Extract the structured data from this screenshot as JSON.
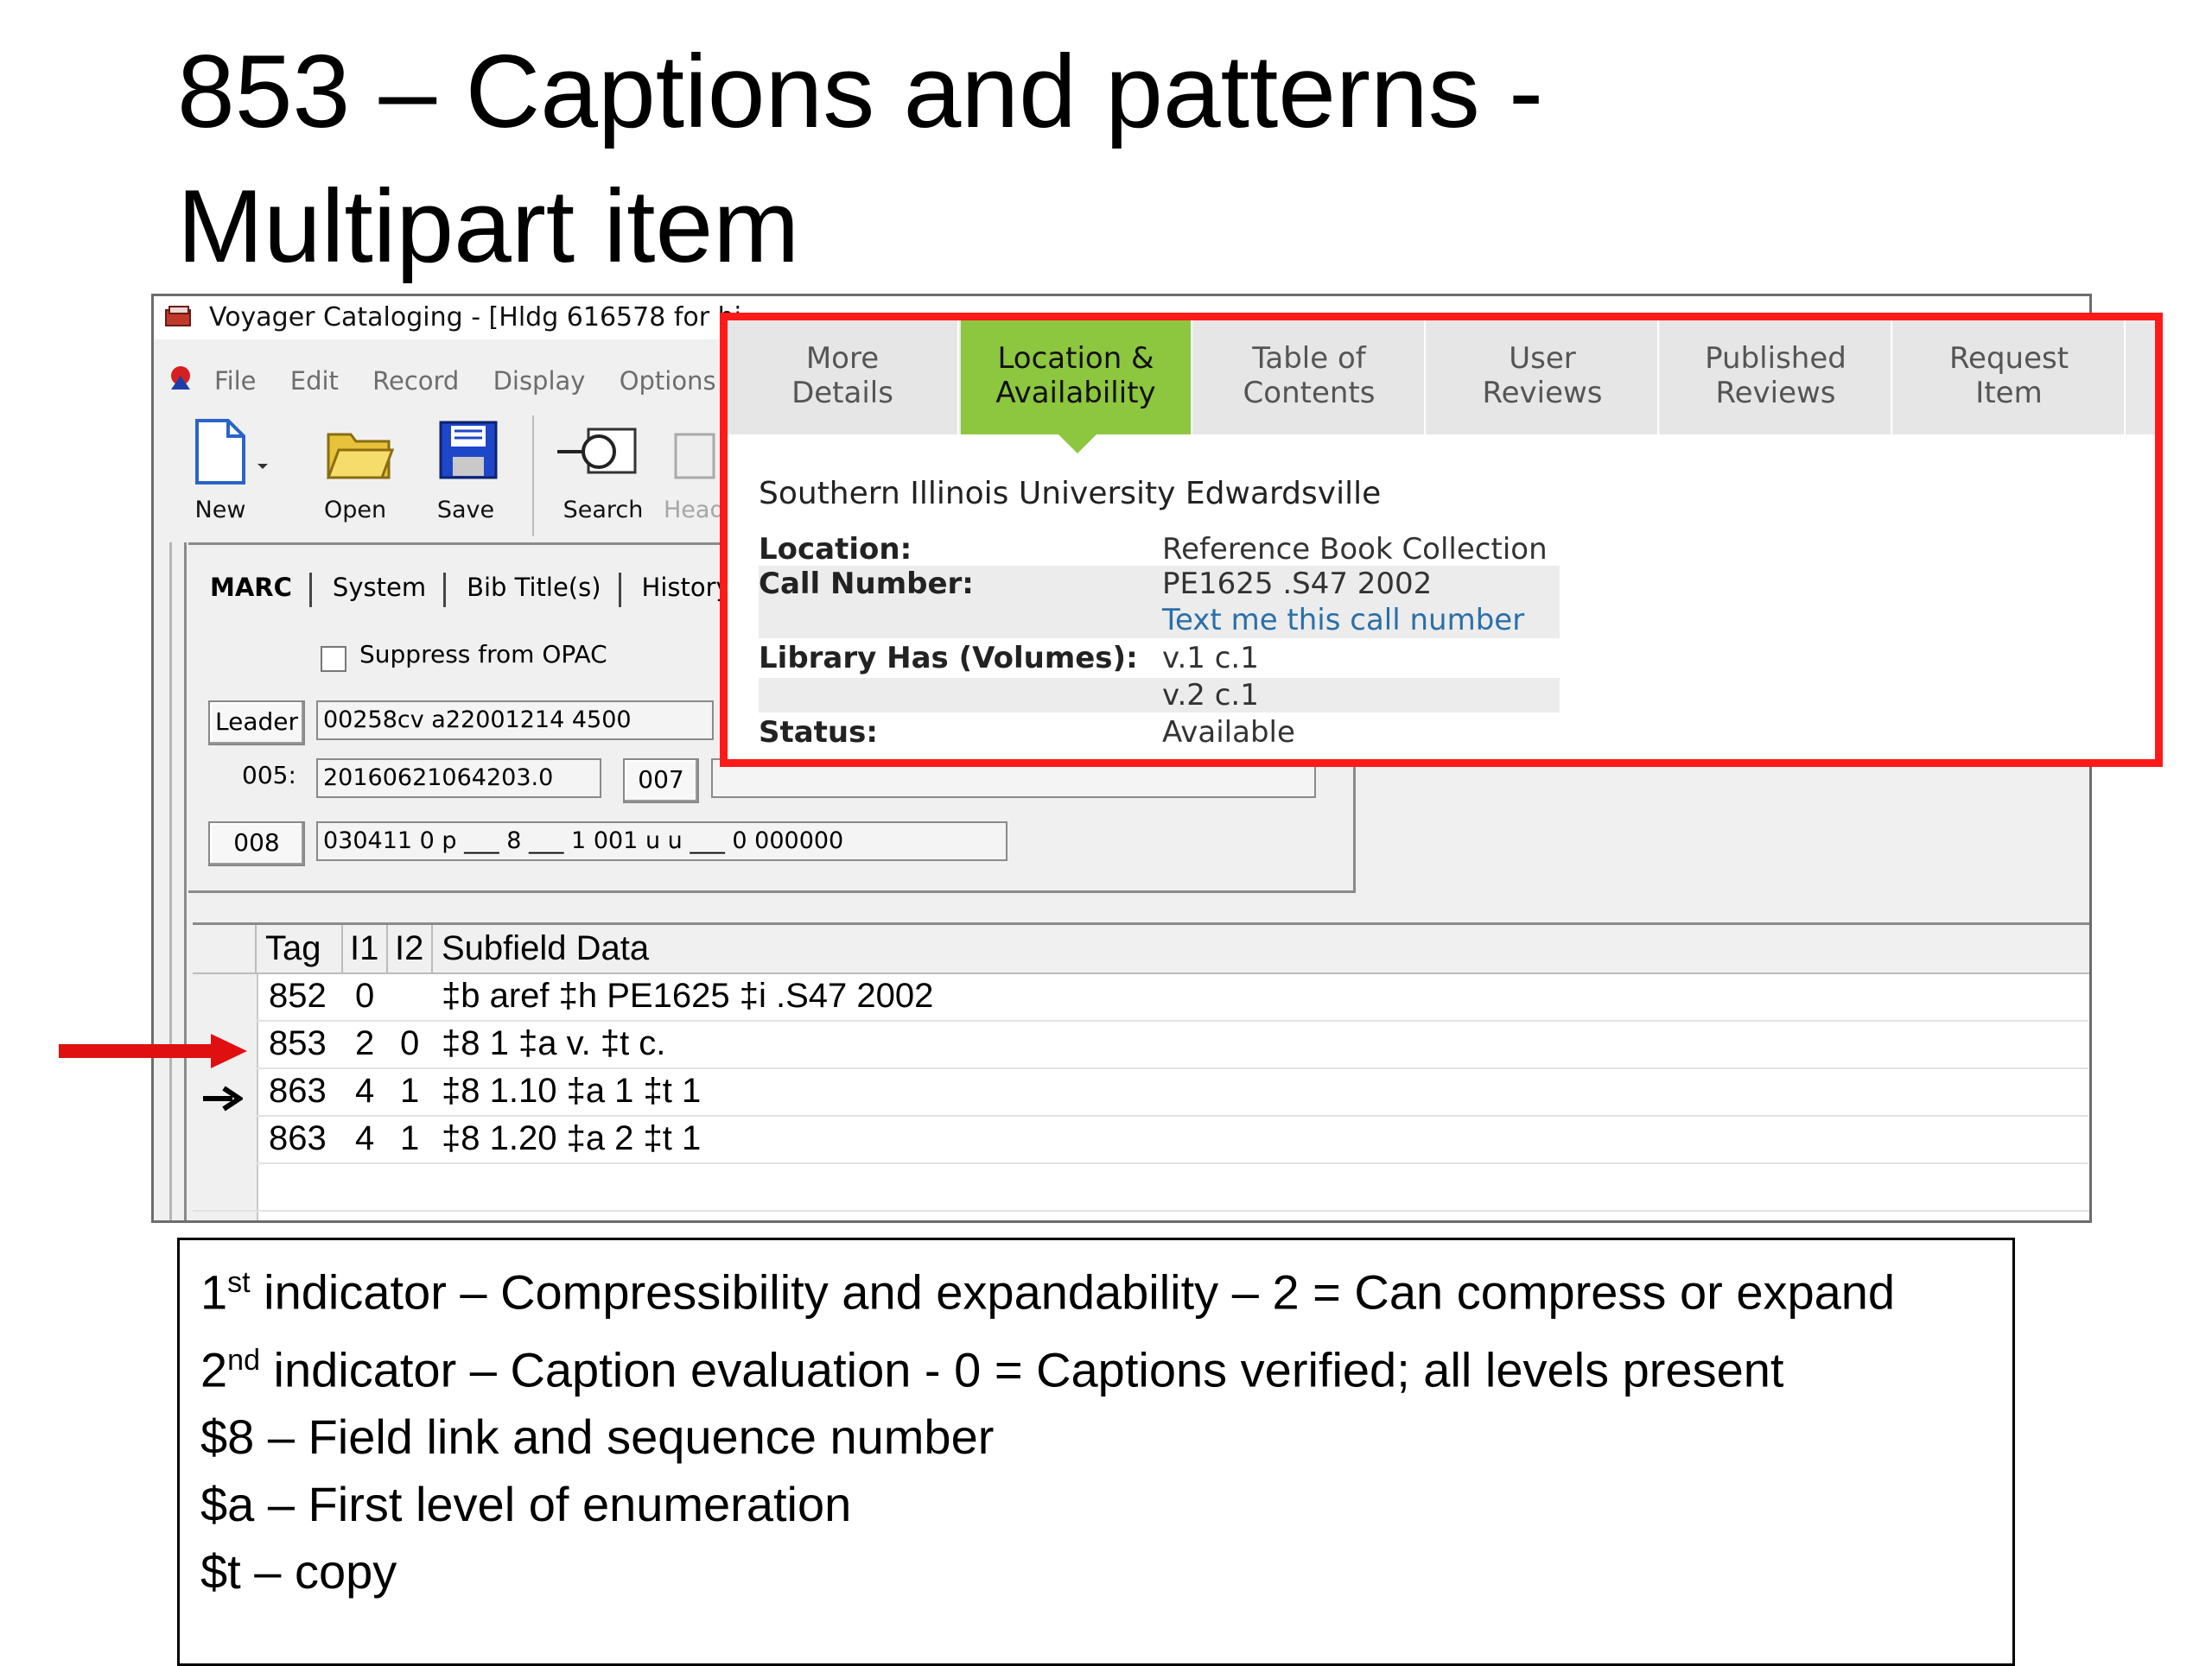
{
  "slide": {
    "title_line1": "853 – Captions and patterns -",
    "title_line2": "Multipart item"
  },
  "window": {
    "title": "Voyager Cataloging - [Hldg 616578 for bi",
    "menu": [
      "File",
      "Edit",
      "Record",
      "Display",
      "Options"
    ],
    "toolbar": {
      "new": "New",
      "open": "Open",
      "save": "Save",
      "search": "Search",
      "head": "Head"
    },
    "tabs": [
      "MARC",
      "System",
      "Bib Title(s)",
      "History"
    ],
    "suppress_label": "Suppress from OPAC",
    "leader_button": "Leader",
    "leader_value": "00258cv  a22001214  4500",
    "label_005": "005:",
    "value_005": "20160621064203.0",
    "button_007": "007",
    "button_008": "008",
    "value_008": "030411  0  p ___  8 ___  1  001  u  u ___  0  000000"
  },
  "grid": {
    "headers": [
      "Tag",
      "I1",
      "I2",
      "Subfield Data"
    ],
    "rows": [
      {
        "tag": "852",
        "i1": "0",
        "i2": "",
        "data": "‡b aref ‡h PE1625 ‡i .S47 2002"
      },
      {
        "tag": "853",
        "i1": "2",
        "i2": "0",
        "data": "‡8 1 ‡a v. ‡t c."
      },
      {
        "tag": "863",
        "i1": "4",
        "i2": "1",
        "data": "‡8 1.10 ‡a 1 ‡t 1"
      },
      {
        "tag": "863",
        "i1": "4",
        "i2": "1",
        "data": "‡8 1.20 ‡a 2 ‡t 1"
      }
    ]
  },
  "popup": {
    "tabs": [
      {
        "line1": "More",
        "line2": "Details"
      },
      {
        "line1": "Location &",
        "line2": "Availability"
      },
      {
        "line1": "Table of",
        "line2": "Contents"
      },
      {
        "line1": "User",
        "line2": "Reviews"
      },
      {
        "line1": "Published",
        "line2": "Reviews"
      },
      {
        "line1": "Request",
        "line2": "Item"
      }
    ],
    "institution": "Southern Illinois University Edwardsville",
    "location_label": "Location:",
    "location_value": "Reference Book Collection",
    "call_label": "Call Number:",
    "call_value": "PE1625 .S47 2002",
    "text_link": "Text me this call number",
    "has_label": "Library Has (Volumes):",
    "has_value1": "v.1 c.1",
    "has_value2": "v.2 c.1",
    "status_label": "Status:",
    "status_value": "Available"
  },
  "notes": {
    "line1_num": "1",
    "line1_sup": "st",
    "line1_rest": " indicator – Compressibility and expandability – 2 = Can compress or expand",
    "line2_num": "2",
    "line2_sup": "nd",
    "line2_rest": " indicator – Caption evaluation - 0 = Captions verified; all levels present",
    "line3": "$8 – Field link and sequence number",
    "line4": "$a – First level of enumeration",
    "line5": "$t – copy"
  },
  "colors": {
    "highlight_border": "#ff1a1a",
    "active_tab": "#8dc63f",
    "link": "#2a6fa8",
    "arrow": "#e01010"
  }
}
